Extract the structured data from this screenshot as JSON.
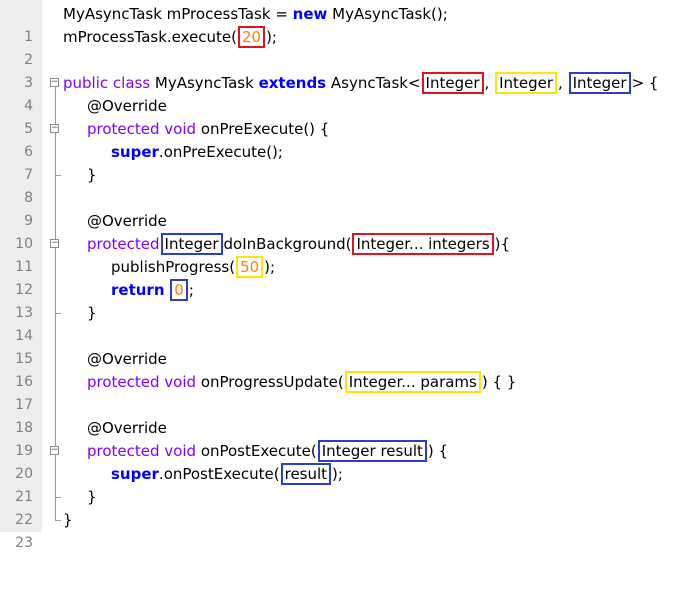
{
  "lines": [
    {
      "n": "1"
    },
    {
      "n": "2"
    },
    {
      "n": "3"
    },
    {
      "n": "4"
    },
    {
      "n": "5"
    },
    {
      "n": "6"
    },
    {
      "n": "7"
    },
    {
      "n": "8"
    },
    {
      "n": "9"
    },
    {
      "n": "10"
    },
    {
      "n": "11"
    },
    {
      "n": "12"
    },
    {
      "n": "13"
    },
    {
      "n": "14"
    },
    {
      "n": "15"
    },
    {
      "n": "16"
    },
    {
      "n": "17"
    },
    {
      "n": "18"
    },
    {
      "n": "19"
    },
    {
      "n": "20"
    },
    {
      "n": "21"
    },
    {
      "n": "22"
    },
    {
      "n": "23"
    }
  ],
  "code": {
    "l1": {
      "a": "MyAsyncTask mProcessTask = ",
      "kw": "new",
      "b": " MyAsyncTask();"
    },
    "l2": {
      "a": "mProcessTask.execute(",
      "num": "20",
      "b": ");"
    },
    "l4": {
      "mod": "public class",
      "a": " MyAsyncTask ",
      "kw": "extends",
      "b": " AsyncTask<",
      "t1": "Integer",
      "s1": ",",
      "t2": "Integer",
      "s2": ",",
      "t3": "Integer",
      "c": "> {"
    },
    "l5": {
      "a": "@Override"
    },
    "l6": {
      "mod": "protected void",
      "a": " onPreExecute() {"
    },
    "l7": {
      "kw": "super",
      "a": ".onPreExecute();"
    },
    "l8": {
      "a": "}"
    },
    "l10": {
      "a": "@Override"
    },
    "l11": {
      "mod": "protected",
      "ret": "Integer",
      "a": "doInBackground(",
      "param": "Integer... integers",
      "b": "){"
    },
    "l12": {
      "a": "publishProgress(",
      "num": "50",
      "b": ");"
    },
    "l13": {
      "kw": "return",
      "num": "0",
      "b": ";"
    },
    "l14": {
      "a": "}"
    },
    "l16": {
      "a": "@Override"
    },
    "l17": {
      "mod": "protected void",
      "a": " onProgressUpdate(",
      "param": "Integer... params",
      "b": ") { }"
    },
    "l19": {
      "a": "@Override"
    },
    "l20": {
      "mod": "protected void",
      "a": " onPostExecute(",
      "param": "Integer result",
      "b": ") {"
    },
    "l21": {
      "kw": "super",
      "a": ".onPostExecute(",
      "arg": "result",
      "b": ");"
    },
    "l22": {
      "a": "}"
    },
    "l23": {
      "a": "}"
    }
  }
}
